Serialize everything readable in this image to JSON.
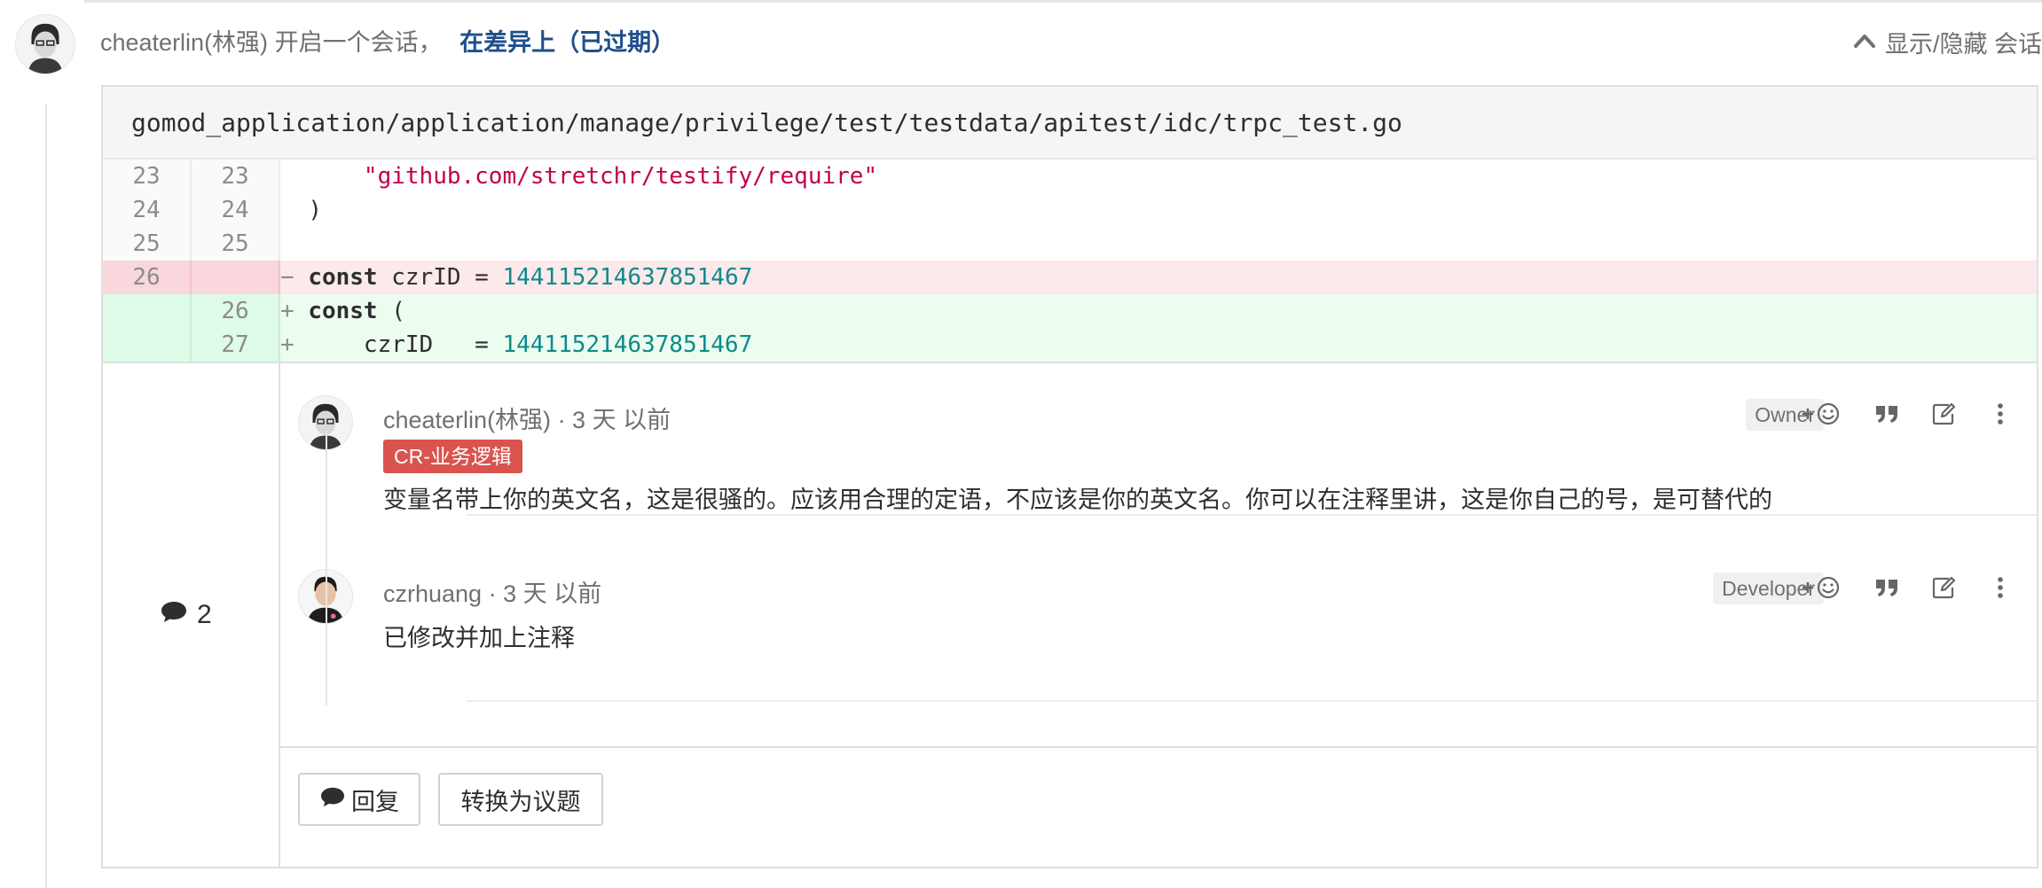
{
  "header": {
    "author": "cheaterlin(林强)",
    "action": "开启一个会话，",
    "link": "在差异上（已过期）",
    "toggle_label": "显示/隐藏 会话"
  },
  "file": {
    "path": "gomod_application/application/manage/privilege/test/testdata/apitest/idc/trpc_test.go"
  },
  "diff": {
    "lines": [
      {
        "type": "ctx",
        "old": "23",
        "new": "23",
        "sign": " ",
        "code": "    \"github.com/stretchr/testify/require\""
      },
      {
        "type": "ctx",
        "old": "24",
        "new": "24",
        "sign": " ",
        "code": ")"
      },
      {
        "type": "ctx",
        "old": "25",
        "new": "25",
        "sign": " ",
        "code": ""
      },
      {
        "type": "del",
        "old": "26",
        "new": "",
        "sign": "−",
        "code": "const czrID = 144115214637851467"
      },
      {
        "type": "add",
        "old": "",
        "new": "26",
        "sign": "+",
        "code": "const ("
      },
      {
        "type": "add",
        "old": "",
        "new": "27",
        "sign": "+",
        "code": "    czrID   = 144115214637851467"
      }
    ]
  },
  "discussion": {
    "count": "2",
    "notes": [
      {
        "author": "cheaterlin(林强)",
        "meta": " · 3 天 以前",
        "role": "Owner",
        "label": "CR-业务逻辑",
        "body": "变量名带上你的英文名，这是很骚的。应该用合理的定语，不应该是你的英文名。你可以在注释里讲，这是你自己的号，是可替代的"
      },
      {
        "author": "czrhuang",
        "meta": " · 3 天 以前",
        "role": "Developer",
        "body": "已修改并加上注释"
      }
    ],
    "reply_label": "回复",
    "convert_label": "转换为议题"
  },
  "colors": {
    "link": "#1f4e8c",
    "label_bg": "#d9534f",
    "del_bg": "#fbe9eb",
    "add_bg": "#ecfdf0",
    "string": "#c00050",
    "number": "#0f8a8a"
  },
  "icons": [
    "user-avatar",
    "chevron-up-icon",
    "comment-icon",
    "add-reaction-icon",
    "quote-icon",
    "edit-icon",
    "more-vertical-icon"
  ]
}
